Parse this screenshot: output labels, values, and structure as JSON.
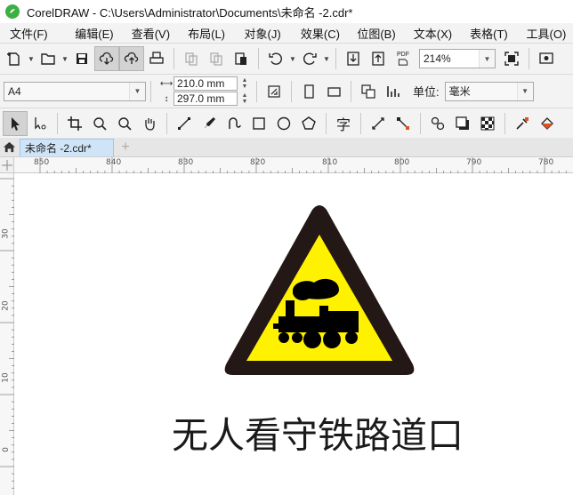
{
  "window": {
    "title": "CorelDRAW - C:\\Users\\Administrator\\Documents\\未命名 -2.cdr*"
  },
  "menu": [
    "文件(F)",
    "编辑(E)",
    "查看(V)",
    "布局(L)",
    "对象(J)",
    "效果(C)",
    "位图(B)",
    "文本(X)",
    "表格(T)",
    "工具(O)"
  ],
  "toolbar_standard": {
    "zoom_value": "214%",
    "pdf_label": "PDF"
  },
  "property_bar": {
    "page_size": "A4",
    "width_value": "210.0 mm",
    "height_value": "297.0 mm",
    "unit_label": "单位:",
    "unit_value": "毫米"
  },
  "toolbox": {
    "text_tool_glyph": "字"
  },
  "document_tabs": [
    {
      "label": "未命名 -2.cdr*"
    }
  ],
  "ruler": {
    "horizontal_labels": [
      "850",
      "840",
      "830",
      "820",
      "810",
      "800",
      "790",
      "780"
    ],
    "vertical_labels": [
      "30",
      "20",
      "10",
      "0"
    ]
  },
  "canvas": {
    "sign_caption": "无人看守铁路道口",
    "sign_colors": {
      "outer": "#231815",
      "inner": "#fff200",
      "figure": "#000000"
    }
  }
}
